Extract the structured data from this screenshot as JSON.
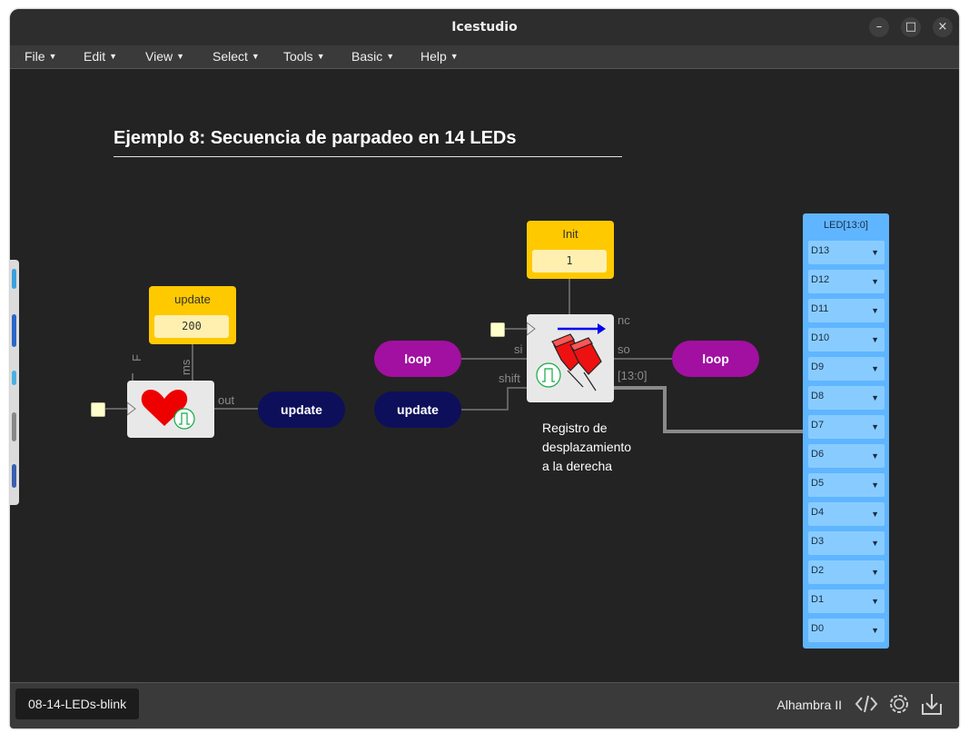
{
  "window": {
    "title": "Icestudio"
  },
  "controls": {
    "minimize": "–",
    "maximize": "□",
    "close": "×"
  },
  "menu": [
    {
      "label": "File"
    },
    {
      "label": "Edit"
    },
    {
      "label": "View"
    },
    {
      "label": "Select"
    },
    {
      "label": "Tools"
    },
    {
      "label": "Basic"
    },
    {
      "label": "Help"
    }
  ],
  "canvas": {
    "heading": "Ejemplo 8: Secuencia de parpadeo en 14 LEDs",
    "constants": {
      "update": {
        "label": "update",
        "value": "200"
      },
      "init": {
        "label": "Init",
        "value": "1"
      }
    },
    "heartbeat": {
      "port_f": "F",
      "port_ms": "ms",
      "port_out": "out"
    },
    "shift_register": {
      "port_si": "si",
      "port_shift": "shift",
      "port_nc": "nc",
      "port_so": "so",
      "port_bus": "[13:0]",
      "note": [
        "Registro de",
        "desplazamiento",
        "a la derecha"
      ]
    },
    "labels": {
      "update_out": "update",
      "loop_in": "loop",
      "update_in": "update",
      "loop_out": "loop"
    },
    "led_panel": {
      "title": "LED[13:0]",
      "pins": [
        "D13",
        "D12",
        "D11",
        "D10",
        "D9",
        "D8",
        "D7",
        "D6",
        "D5",
        "D4",
        "D3",
        "D2",
        "D1",
        "D0"
      ]
    }
  },
  "footer": {
    "project": "08-14-LEDs-blink",
    "board": "Alhambra II"
  },
  "colors": {
    "background": "#232323",
    "constant": "#ffc900",
    "label_purple": "#a110a0",
    "label_navy": "#0d0f5a",
    "led_panel": "#5fb5ff"
  }
}
